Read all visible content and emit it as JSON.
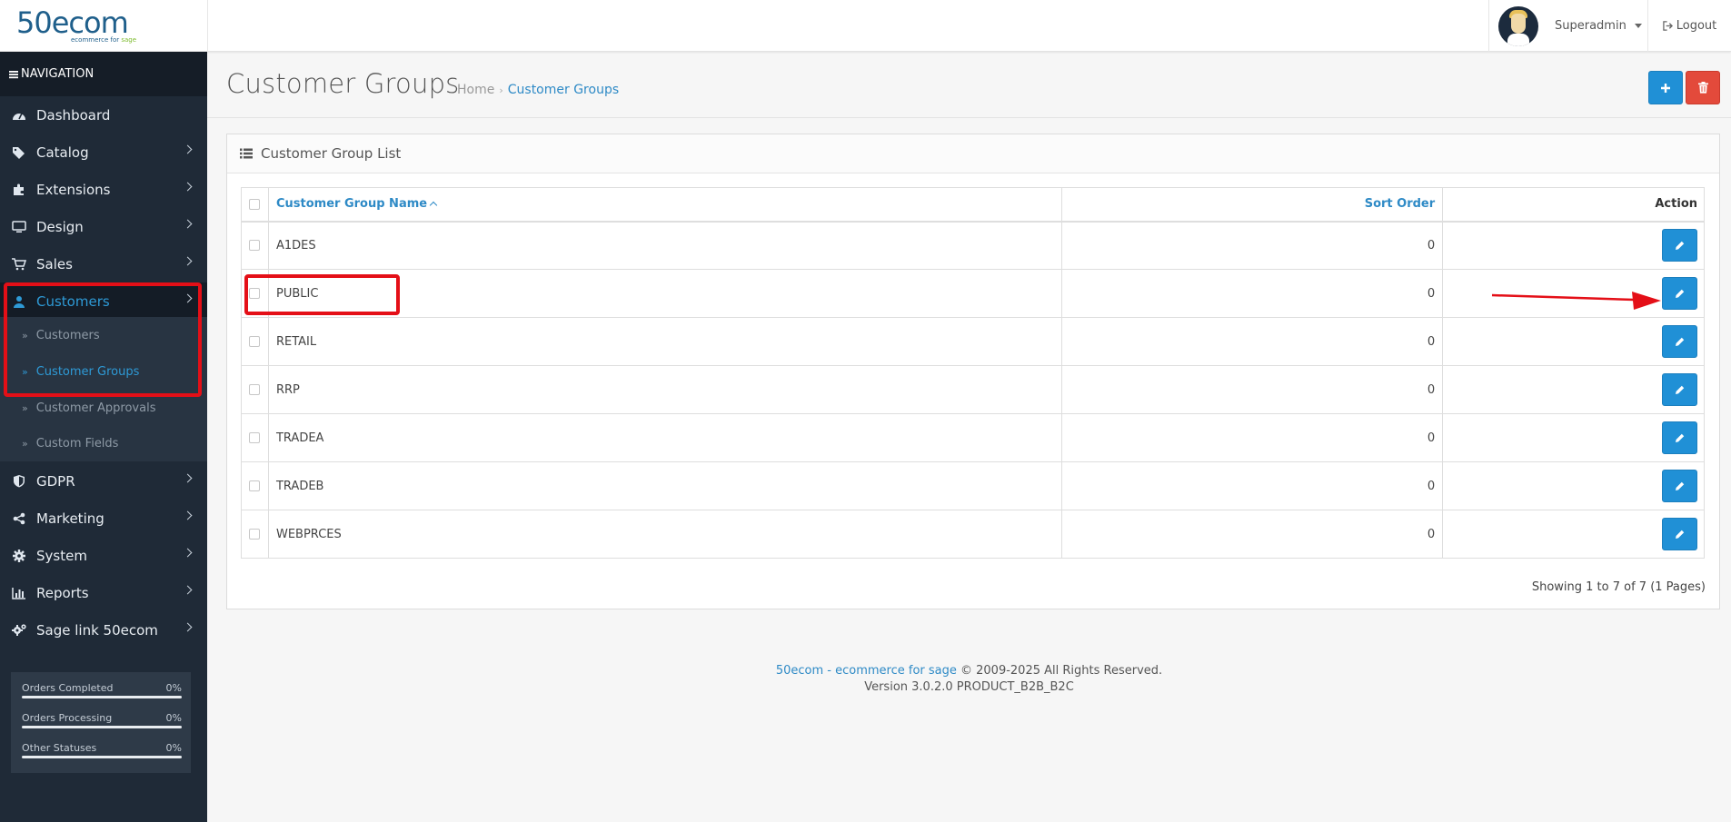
{
  "header": {
    "logo": {
      "main_num": "50",
      "main_text": "ecom",
      "sub": "ecommerce for",
      "sub_accent": "sage"
    },
    "user_name": "Superadmin",
    "logout_label": "Logout"
  },
  "sidebar": {
    "nav_title": "NAVIGATION",
    "items": [
      {
        "label": "Dashboard",
        "icon": "dashboard-icon"
      },
      {
        "label": "Catalog",
        "icon": "tags-icon"
      },
      {
        "label": "Extensions",
        "icon": "puzzle-icon"
      },
      {
        "label": "Design",
        "icon": "desktop-icon"
      },
      {
        "label": "Sales",
        "icon": "cart-icon"
      },
      {
        "label": "Customers",
        "icon": "user-icon"
      },
      {
        "label": "GDPR",
        "icon": "shield-icon"
      },
      {
        "label": "Marketing",
        "icon": "share-icon"
      },
      {
        "label": "System",
        "icon": "gear-icon"
      },
      {
        "label": "Reports",
        "icon": "bar-chart-icon"
      },
      {
        "label": "Sage link 50ecom",
        "icon": "gears-icon"
      }
    ],
    "sub_items": [
      {
        "label": "Customers"
      },
      {
        "label": "Customer Groups"
      },
      {
        "label": "Customer Approvals"
      },
      {
        "label": "Custom Fields"
      }
    ],
    "stats": [
      {
        "label": "Orders Completed",
        "value": "0%",
        "fraction": 0
      },
      {
        "label": "Orders Processing",
        "value": "0%",
        "fraction": 0
      },
      {
        "label": "Other Statuses",
        "value": "0%",
        "fraction": 0
      }
    ]
  },
  "page": {
    "title": "Customer Groups",
    "breadcrumb": {
      "home": "Home",
      "separator": "›",
      "current": "Customer Groups"
    }
  },
  "panel": {
    "title": "Customer Group List",
    "columns": {
      "name": "Customer Group Name",
      "sort": "Sort Order",
      "action": "Action"
    },
    "rows": [
      {
        "name": "A1DES",
        "sort": "0"
      },
      {
        "name": "PUBLIC",
        "sort": "0"
      },
      {
        "name": "RETAIL",
        "sort": "0"
      },
      {
        "name": "RRP",
        "sort": "0"
      },
      {
        "name": "TRADEA",
        "sort": "0"
      },
      {
        "name": "TRADEB",
        "sort": "0"
      },
      {
        "name": "WEBPRCES",
        "sort": "0"
      }
    ],
    "pager_info": "Showing 1 to 7 of 7 (1 Pages)"
  },
  "footer": {
    "link": "50ecom - ecommerce for sage",
    "copyright": " © 2009-2025 All Rights Reserved.",
    "version": "Version 3.0.2.0 PRODUCT_B2B_B2C"
  },
  "colors": {
    "accent": "#2090d6",
    "danger": "#e34a3b",
    "sidebar_bg": "#1f2a37",
    "annotation": "#e40f17"
  }
}
